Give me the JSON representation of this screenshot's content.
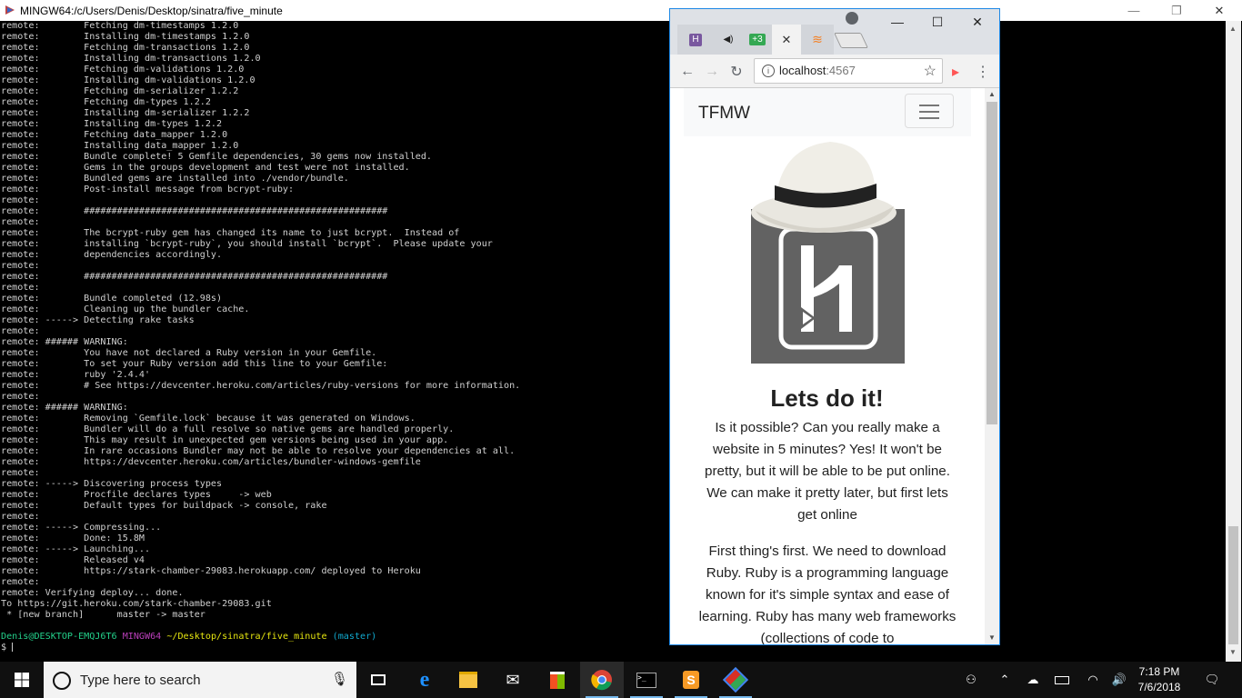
{
  "terminal": {
    "title": "MINGW64:/c/Users/Denis/Desktop/sinatra/five_minute",
    "lines": [
      "remote:        Fetching dm-timestamps 1.2.0",
      "remote:        Installing dm-timestamps 1.2.0",
      "remote:        Fetching dm-transactions 1.2.0",
      "remote:        Installing dm-transactions 1.2.0",
      "remote:        Fetching dm-validations 1.2.0",
      "remote:        Installing dm-validations 1.2.0",
      "remote:        Fetching dm-serializer 1.2.2",
      "remote:        Fetching dm-types 1.2.2",
      "remote:        Installing dm-serializer 1.2.2",
      "remote:        Installing dm-types 1.2.2",
      "remote:        Fetching data_mapper 1.2.0",
      "remote:        Installing data_mapper 1.2.0",
      "remote:        Bundle complete! 5 Gemfile dependencies, 30 gems now installed.",
      "remote:        Gems in the groups development and test were not installed.",
      "remote:        Bundled gems are installed into ./vendor/bundle.",
      "remote:        Post-install message from bcrypt-ruby:",
      "remote:",
      "remote:        #######################################################",
      "remote:",
      "remote:        The bcrypt-ruby gem has changed its name to just bcrypt.  Instead of",
      "remote:        installing `bcrypt-ruby`, you should install `bcrypt`.  Please update your",
      "remote:        dependencies accordingly.",
      "remote:",
      "remote:        #######################################################",
      "remote:",
      "remote:        Bundle completed (12.98s)",
      "remote:        Cleaning up the bundler cache.",
      "remote: -----> Detecting rake tasks",
      "remote:",
      "remote: ###### WARNING:",
      "remote:        You have not declared a Ruby version in your Gemfile.",
      "remote:        To set your Ruby version add this line to your Gemfile:",
      "remote:        ruby '2.4.4'",
      "remote:        # See https://devcenter.heroku.com/articles/ruby-versions for more information.",
      "remote:",
      "remote: ###### WARNING:",
      "remote:        Removing `Gemfile.lock` because it was generated on Windows.",
      "remote:        Bundler will do a full resolve so native gems are handled properly.",
      "remote:        This may result in unexpected gem versions being used in your app.",
      "remote:        In rare occasions Bundler may not be able to resolve your dependencies at all.",
      "remote:        https://devcenter.heroku.com/articles/bundler-windows-gemfile",
      "remote:",
      "remote: -----> Discovering process types",
      "remote:        Procfile declares types     -> web",
      "remote:        Default types for buildpack -> console, rake",
      "remote:",
      "remote: -----> Compressing...",
      "remote:        Done: 15.8M",
      "remote: -----> Launching...",
      "remote:        Released v4",
      "remote:        https://stark-chamber-29083.herokuapp.com/ deployed to Heroku",
      "remote:",
      "remote: Verifying deploy... done.",
      "To https://git.heroku.com/stark-chamber-29083.git",
      " * [new branch]      master -> master",
      ""
    ],
    "prompt": {
      "user": "Denis@DESKTOP-EMQJ6T6",
      "host": "MINGW64",
      "path": "~/Desktop/sinatra/five_minute",
      "branch": "(master)",
      "symbol": "$"
    }
  },
  "browser": {
    "tabs": [
      {
        "icon": "heroku-favicon-icon",
        "label": "H"
      },
      {
        "icon": "audio-icon",
        "label": "◀)"
      },
      {
        "icon": "badge-icon",
        "label": "+3"
      },
      {
        "icon": "close-icon",
        "label": "✕"
      },
      {
        "icon": "stackoverflow-icon",
        "label": "≋"
      }
    ],
    "url_host": "localhost",
    "url_port": ":4567",
    "page": {
      "brand": "TFMW",
      "headline": "Lets do it!",
      "paragraph1": "Is it possible? Can you really make a website in 5 minutes? Yes! It won't be pretty, but it will be able to be put online. We can make it pretty later, but first lets get online",
      "paragraph2": "First thing's first. We need to download Ruby. Ruby is a programming language known for it's simple syntax and ease of learning. Ruby has many web frameworks (collections of code to"
    }
  },
  "taskbar": {
    "search_placeholder": "Type here to search",
    "time": "7:18 PM",
    "date": "7/6/2018"
  },
  "colors": {
    "accent": "#1e88e5",
    "prompt_user": "#23d18b",
    "prompt_host": "#bc3fbc",
    "prompt_path": "#e5e510",
    "prompt_branch": "#11a8cd"
  }
}
